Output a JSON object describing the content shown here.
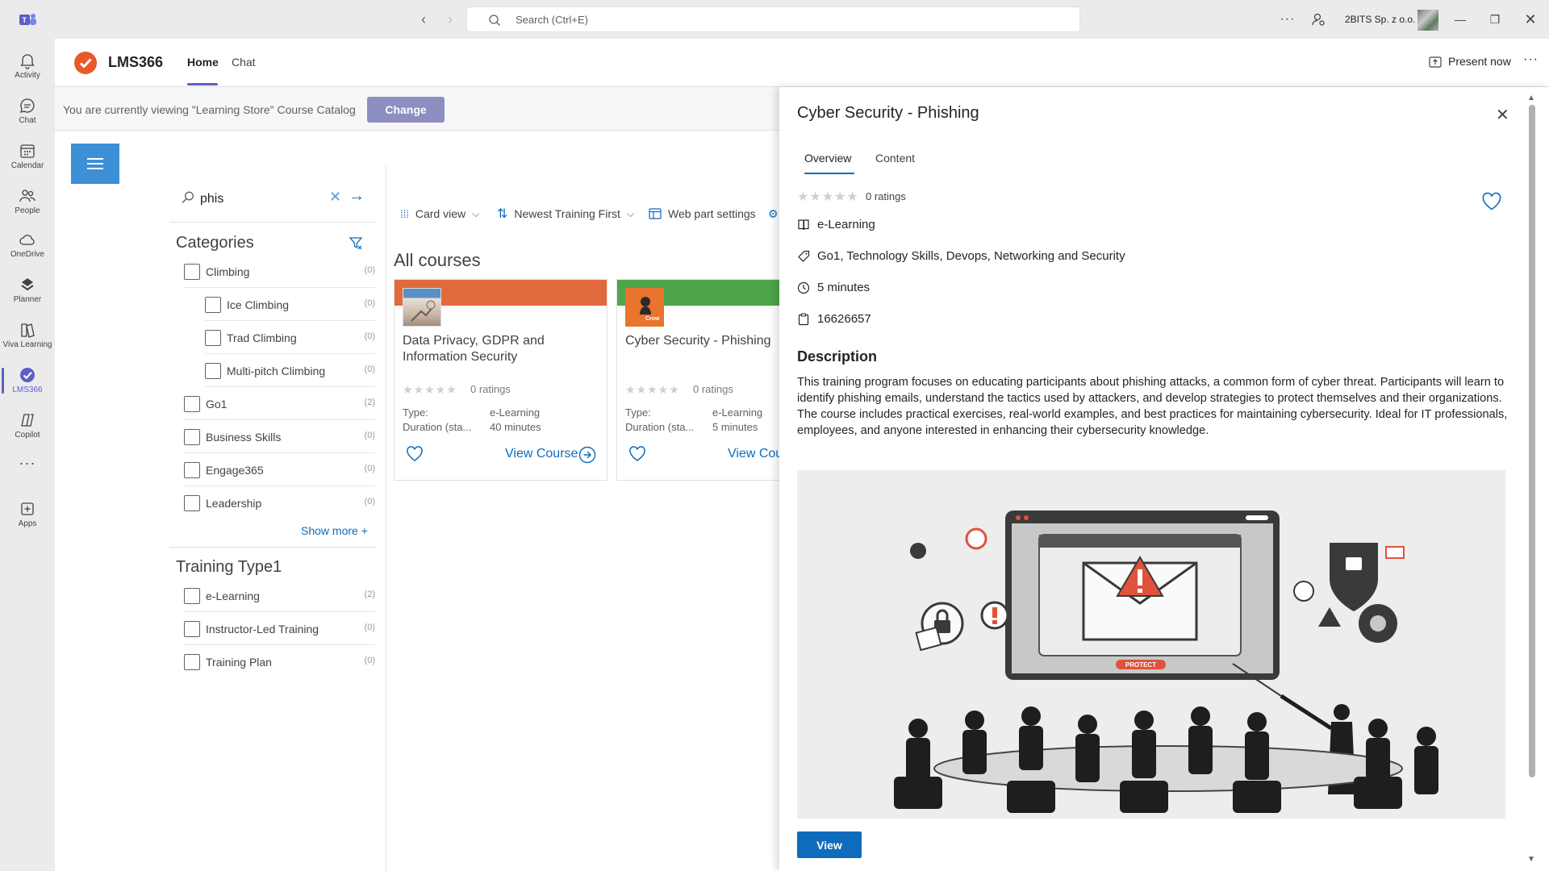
{
  "titlebar": {
    "search_placeholder": "Search (Ctrl+E)",
    "more": "···",
    "org": "2BITS Sp. z o.o."
  },
  "rail": [
    {
      "label": "Activity",
      "icon": "bell-icon"
    },
    {
      "label": "Chat",
      "icon": "chat-icon"
    },
    {
      "label": "Calendar",
      "icon": "calendar-icon"
    },
    {
      "label": "People",
      "icon": "people-icon"
    },
    {
      "label": "OneDrive",
      "icon": "cloud-icon"
    },
    {
      "label": "Planner",
      "icon": "planner-icon"
    },
    {
      "label": "Viva Learning",
      "icon": "book-icon"
    },
    {
      "label": "LMS366",
      "icon": "lms-icon"
    },
    {
      "label": "Copilot",
      "icon": "copilot-icon"
    },
    {
      "label": "···",
      "icon": "more-icon"
    },
    {
      "label": "Apps",
      "icon": "apps-icon"
    }
  ],
  "app": {
    "name": "LMS366",
    "tabs": [
      "Home",
      "Chat"
    ],
    "present": "Present now",
    "more": "···",
    "brand_color": "#e8582a",
    "accent_color": "#5b5fc7"
  },
  "catalog": {
    "text": "You are currently viewing \"Learning Store\" Course Catalog",
    "change": "Change"
  },
  "filters": {
    "search_value": "phis",
    "categories_title": "Categories",
    "categories": [
      {
        "label": "Climbing",
        "count": "(0)"
      },
      {
        "label": "Ice Climbing",
        "count": "(0)"
      },
      {
        "label": "Trad Climbing",
        "count": "(0)"
      },
      {
        "label": "Multi-pitch Climbing",
        "count": "(0)"
      },
      {
        "label": "Go1",
        "count": "(2)"
      },
      {
        "label": "Business Skills",
        "count": "(0)"
      },
      {
        "label": "Engage365",
        "count": "(0)"
      },
      {
        "label": "Leadership",
        "count": "(0)"
      }
    ],
    "show_more": "Show more +",
    "type_title": "Training Type1",
    "types": [
      {
        "label": "e-Learning",
        "count": "(2)"
      },
      {
        "label": "Instructor-Led Training",
        "count": "(0)"
      },
      {
        "label": "Training Plan",
        "count": "(0)"
      }
    ]
  },
  "toolbar": {
    "view": "Card view",
    "sort": "Newest Training First",
    "settings": "Web part settings"
  },
  "courses": {
    "heading": "All courses",
    "items": [
      {
        "title": "Data Privacy, GDPR and Information Security",
        "ratings": "0 ratings",
        "type_label": "Type:",
        "type": "e-Learning",
        "duration_label": "Duration (sta...",
        "duration": "40 minutes",
        "view": "View Course",
        "band_color": "#e06a3c"
      },
      {
        "title": "Cyber Security - Phishing",
        "ratings": "0 ratings",
        "type_label": "Type:",
        "type": "e-Learning",
        "duration_label": "Duration (sta...",
        "duration": "5 minutes",
        "view": "View Cou",
        "band_color": "#4ea54a",
        "thumb_text": "Crow"
      }
    ]
  },
  "detail": {
    "title": "Cyber Security - Phishing",
    "tabs": [
      "Overview",
      "Content"
    ],
    "ratings": "0 ratings",
    "type": "e-Learning",
    "tags": "Go1, Technology Skills, Devops, Networking and Security",
    "duration": "5 minutes",
    "id": "16626657",
    "description_heading": "Description",
    "description": "This training program focuses on educating participants about phishing attacks, a common form of cyber threat. Participants will learn to identify phishing emails, understand the tactics used by attackers, and develop strategies to protect themselves and their organizations. The course includes practical exercises, real-world examples, and best practices for maintaining cybersecurity. Ideal for IT professionals, employees, and anyone interested in enhancing their cybersecurity knowledge.",
    "image_label": "PROTECT",
    "view": "View"
  }
}
